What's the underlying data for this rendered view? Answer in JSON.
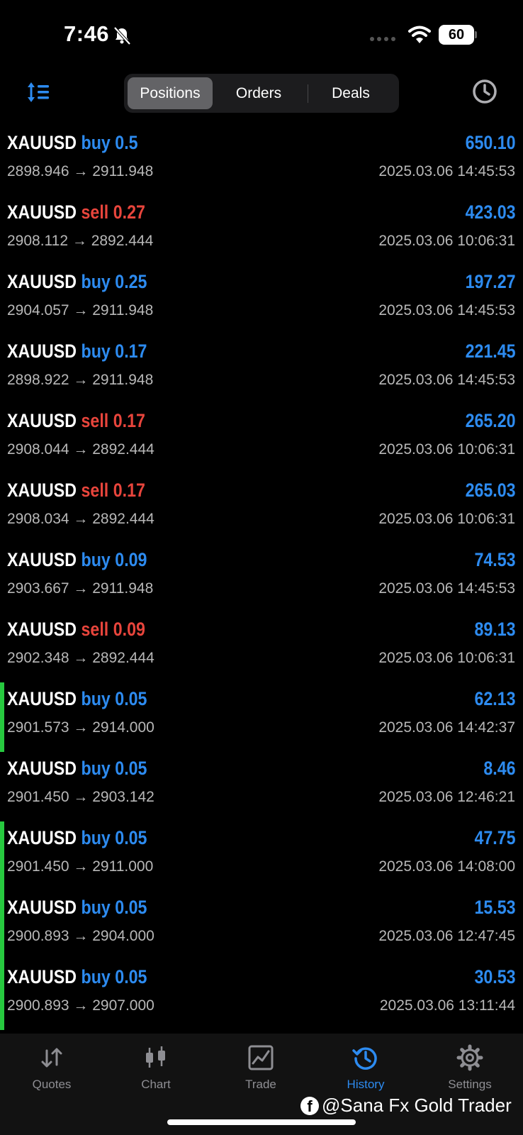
{
  "status_bar": {
    "time": "7:46",
    "battery": "60"
  },
  "toolbar": {
    "segments": [
      "Positions",
      "Orders",
      "Deals"
    ],
    "active_segment": "Positions"
  },
  "colors": {
    "buy": "#2d8bf0",
    "sell": "#e8453c",
    "profit": "#2d8bf0",
    "marker": "#27c93f"
  },
  "deals": [
    {
      "symbol": "XAUUSD",
      "side": "buy",
      "volume": "0.5",
      "prices": "2898.946 → 2911.948",
      "profit": "650.10",
      "time": "2025.03.06 14:45:53",
      "marked": false
    },
    {
      "symbol": "XAUUSD",
      "side": "sell",
      "volume": "0.27",
      "prices": "2908.112 → 2892.444",
      "profit": "423.03",
      "time": "2025.03.06 10:06:31",
      "marked": false
    },
    {
      "symbol": "XAUUSD",
      "side": "buy",
      "volume": "0.25",
      "prices": "2904.057 → 2911.948",
      "profit": "197.27",
      "time": "2025.03.06 14:45:53",
      "marked": false
    },
    {
      "symbol": "XAUUSD",
      "side": "buy",
      "volume": "0.17",
      "prices": "2898.922 → 2911.948",
      "profit": "221.45",
      "time": "2025.03.06 14:45:53",
      "marked": false
    },
    {
      "symbol": "XAUUSD",
      "side": "sell",
      "volume": "0.17",
      "prices": "2908.044 → 2892.444",
      "profit": "265.20",
      "time": "2025.03.06 10:06:31",
      "marked": false
    },
    {
      "symbol": "XAUUSD",
      "side": "sell",
      "volume": "0.17",
      "prices": "2908.034 → 2892.444",
      "profit": "265.03",
      "time": "2025.03.06 10:06:31",
      "marked": false
    },
    {
      "symbol": "XAUUSD",
      "side": "buy",
      "volume": "0.09",
      "prices": "2903.667 → 2911.948",
      "profit": "74.53",
      "time": "2025.03.06 14:45:53",
      "marked": false
    },
    {
      "symbol": "XAUUSD",
      "side": "sell",
      "volume": "0.09",
      "prices": "2902.348 → 2892.444",
      "profit": "89.13",
      "time": "2025.03.06 10:06:31",
      "marked": false
    },
    {
      "symbol": "XAUUSD",
      "side": "buy",
      "volume": "0.05",
      "prices": "2901.573 → 2914.000",
      "profit": "62.13",
      "time": "2025.03.06 14:42:37",
      "marked": true
    },
    {
      "symbol": "XAUUSD",
      "side": "buy",
      "volume": "0.05",
      "prices": "2901.450 → 2903.142",
      "profit": "8.46",
      "time": "2025.03.06 12:46:21",
      "marked": false
    },
    {
      "symbol": "XAUUSD",
      "side": "buy",
      "volume": "0.05",
      "prices": "2901.450 → 2911.000",
      "profit": "47.75",
      "time": "2025.03.06 14:08:00",
      "marked": true
    },
    {
      "symbol": "XAUUSD",
      "side": "buy",
      "volume": "0.05",
      "prices": "2900.893 → 2904.000",
      "profit": "15.53",
      "time": "2025.03.06 12:47:45",
      "marked": true
    },
    {
      "symbol": "XAUUSD",
      "side": "buy",
      "volume": "0.05",
      "prices": "2900.893 → 2907.000",
      "profit": "30.53",
      "time": "2025.03.06 13:11:44",
      "marked": true
    }
  ],
  "tabbar": {
    "tabs": [
      {
        "label": "Quotes",
        "icon": "quotes-arrows-icon"
      },
      {
        "label": "Chart",
        "icon": "candlestick-icon"
      },
      {
        "label": "Trade",
        "icon": "trade-chart-icon"
      },
      {
        "label": "History",
        "icon": "history-clock-icon"
      },
      {
        "label": "Settings",
        "icon": "gear-icon"
      }
    ],
    "active_tab": "History"
  },
  "watermark": {
    "icon_letter": "f",
    "text": "@Sana Fx Gold Trader"
  }
}
